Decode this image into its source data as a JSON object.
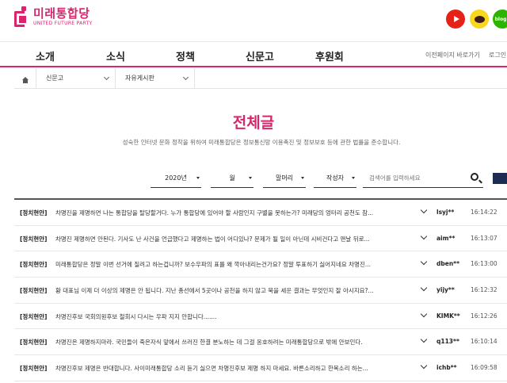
{
  "header": {
    "logo_ko": "미래통합당",
    "logo_en": "UNITED FUTURE PARTY",
    "sns": [
      {
        "name": "youtube",
        "color": "#e62117"
      },
      {
        "name": "kakaotalk",
        "color": "#f9d71c"
      },
      {
        "name": "blog",
        "color": "#2db400",
        "label": "blog"
      }
    ]
  },
  "nav": {
    "items": [
      "소개",
      "소식",
      "정책",
      "신문고",
      "후원회"
    ],
    "util": [
      "이전페이지 바로가기",
      "로그인"
    ]
  },
  "breadcrumb": {
    "items": [
      "신문고",
      "자유게시판"
    ]
  },
  "page": {
    "title": "전체글",
    "description": "성숙한 인터넷 문화 정착을 위하여 미래통합당은 정보통신망 이용촉진 및 정보보호 등에 관한 법률을 준수합니다."
  },
  "filters": {
    "year": "2020년",
    "month": "월",
    "head": "말머리",
    "author": "작성자",
    "search_placeholder": "검색어를 입력하세요"
  },
  "posts": [
    {
      "category": "[정치현안]",
      "title": "차명진을 제명하면 나는 통합당을 탈당할거다. 누가 통합당에 있어야 할 사람인지 구별을 못하는가? 미래당의 엉터리 공천도 참...",
      "author": "lsyj**",
      "time": "16:14:22"
    },
    {
      "category": "[정치현안]",
      "title": "차명진 제명하면 안된다. 기사도 난 사건을 언급했다고 제명하는 법이 어디있나? 문제가 될 일이 아닌데 시비건다고 맨날 뒤로...",
      "author": "aim**",
      "time": "16:13:07"
    },
    {
      "category": "[정치현안]",
      "title": "미래통합당은 정말 이번 선거에 질려고 하는겁니까? 보수우파의 표를 왜 깍아내리는건가요? 정말 투표하기 싫어지네요 차명진...",
      "author": "dben**",
      "time": "16:13:00"
    },
    {
      "category": "[정치현안]",
      "title": "황 대표님 이제 더 이상의 제명은 안 됩니다. 지난 총선에서 5곳이나 공천을 하지 않고 묵을 세운 결과는 무엇인지 잘 아시지요?...",
      "author": "yijy**",
      "time": "16:12:32"
    },
    {
      "category": "[정치현안]",
      "title": "차명진후보 국회의원후보 철회시 다시는 우파 지지 안합니다.......",
      "author": "KIMK**",
      "time": "16:12:26"
    },
    {
      "category": "[정치현안]",
      "title": "차명진은 제명하지마라. 국민들이 죽은자식 앞에서 쓰러진 한결 분노하는 데 그걸 옹호하려는 미래통합당으로 밖에 안보인다.",
      "author": "q113**",
      "time": "16:10:14"
    },
    {
      "category": "[정치현안]",
      "title": "차명진후보 제명은 반대합니다. 사이미래통합당 소리 듣기 싫으면 차명진후보 제명 하지 마세요. 바른소리하고 한목소리 하는...",
      "author": "ichb**",
      "time": "16:09:58"
    }
  ]
}
